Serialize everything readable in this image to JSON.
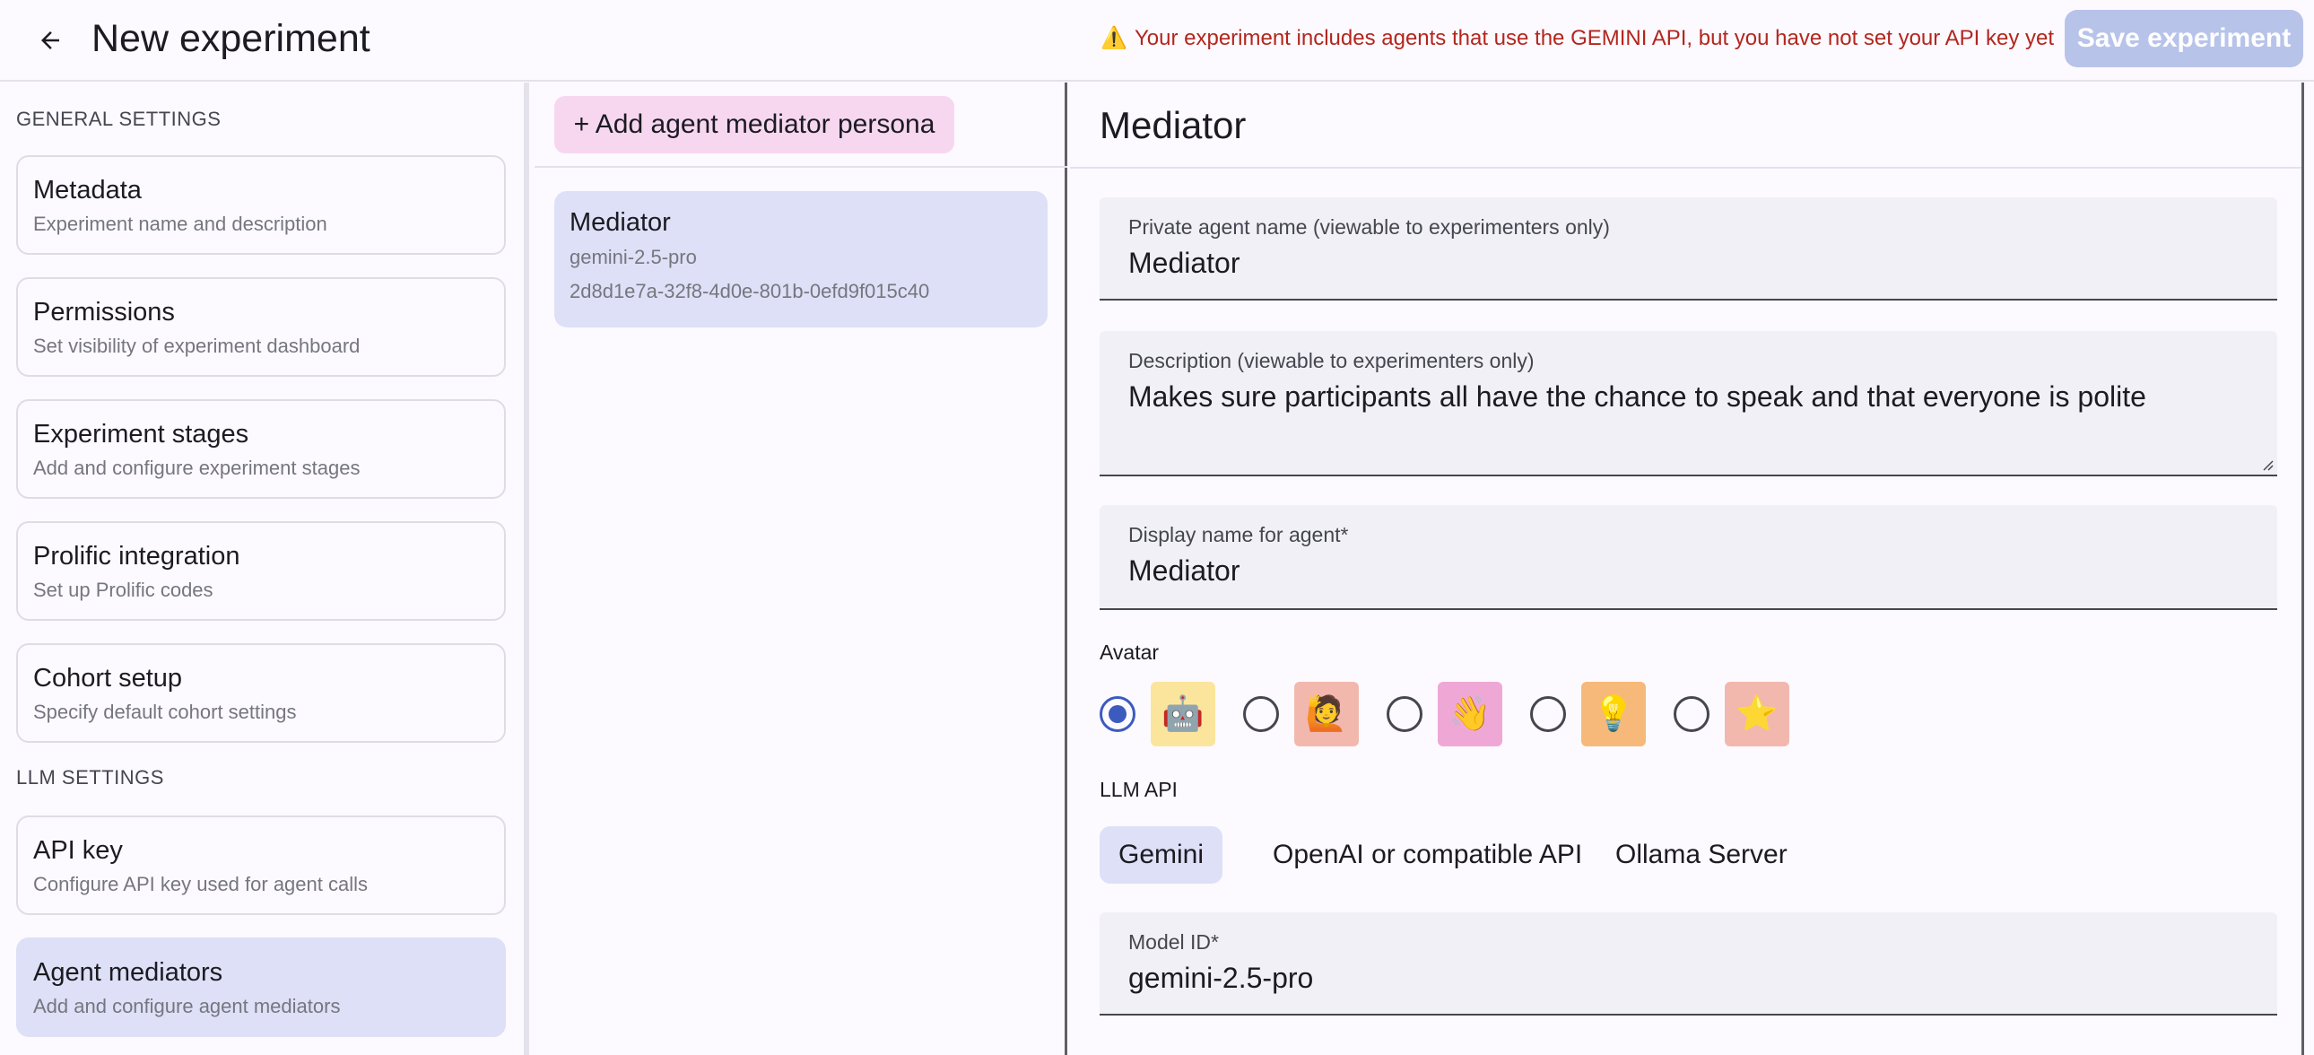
{
  "header": {
    "title": "New experiment",
    "back_icon": "arrow-left-icon",
    "warning_icon": "⚠️",
    "warning_text": "Your experiment includes agents that use the GEMINI API, but you have not set your API key yet",
    "save_label": "Save experiment"
  },
  "sidebar": {
    "general_heading": "GENERAL SETTINGS",
    "llm_heading": "LLM SETTINGS",
    "items": [
      {
        "title": "Metadata",
        "subtitle": "Experiment name and description"
      },
      {
        "title": "Permissions",
        "subtitle": "Set visibility of experiment dashboard"
      },
      {
        "title": "Experiment stages",
        "subtitle": "Add and configure experiment stages"
      },
      {
        "title": "Prolific integration",
        "subtitle": "Set up Prolific codes"
      },
      {
        "title": "Cohort setup",
        "subtitle": "Specify default cohort settings"
      },
      {
        "title": "API key",
        "subtitle": "Configure API key used for agent calls"
      },
      {
        "title": "Agent mediators",
        "subtitle": "Add and configure agent mediators"
      }
    ]
  },
  "middle": {
    "add_button": "+ Add agent mediator persona",
    "persona": {
      "name": "Mediator",
      "model": "gemini-2.5-pro",
      "id": "2d8d1e7a-32f8-4d0e-801b-0efd9f015c40"
    }
  },
  "editor": {
    "title": "Mediator",
    "private_name": {
      "label": "Private agent name (viewable to experimenters only)",
      "value": "Mediator"
    },
    "description": {
      "label": "Description (viewable to experimenters only)",
      "value": "Makes sure participants all have the chance to speak and that everyone is polite"
    },
    "display_name": {
      "label": "Display name for agent*",
      "value": "Mediator"
    },
    "avatar_label": "Avatar",
    "avatars": [
      {
        "emoji": "🤖",
        "color": "#fbe59d",
        "selected": true
      },
      {
        "emoji": "🙋",
        "color": "#f2b8ad",
        "selected": false
      },
      {
        "emoji": "👋",
        "color": "#efa8d6",
        "selected": false
      },
      {
        "emoji": "💡",
        "color": "#f6b97a",
        "selected": false
      },
      {
        "emoji": "⭐",
        "color": "#f2b8ad",
        "selected": false
      }
    ],
    "llm_api_label": "LLM API",
    "api_tabs": [
      "Gemini",
      "OpenAI or compatible API",
      "Ollama Server"
    ],
    "model_id": {
      "label": "Model ID*",
      "value": "gemini-2.5-pro"
    }
  },
  "colors": {
    "accent": "#3c5bbf",
    "active_bg": "#dde0f6",
    "warning": "#b3261e",
    "save_disabled": "#b8c3ea",
    "add_button_bg": "#f7d7f0"
  }
}
